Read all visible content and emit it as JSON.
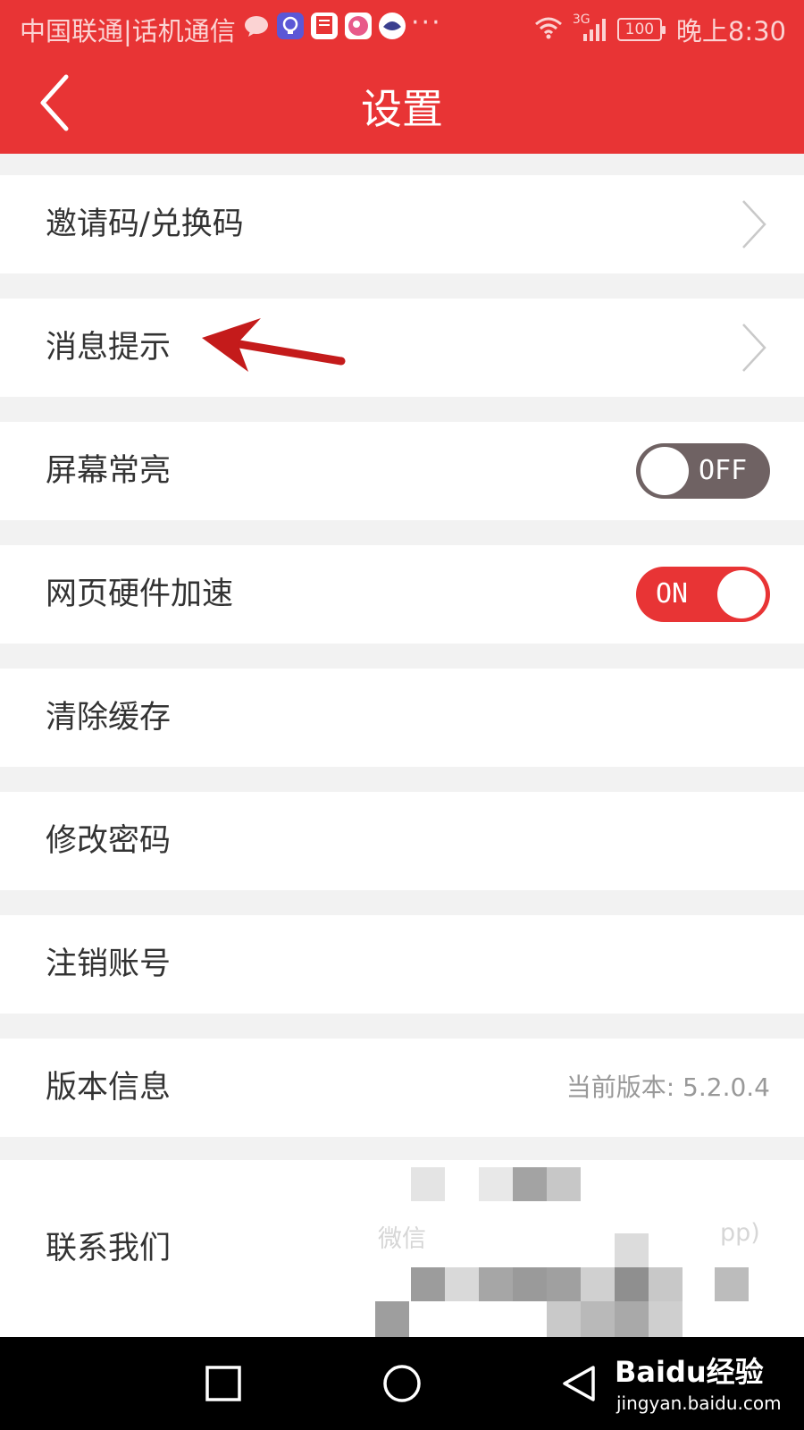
{
  "status_bar": {
    "carrier": "中国联通|话机通信",
    "more": "···",
    "network": "3G",
    "battery": "100",
    "time": "晚上8:30",
    "notification_icons": [
      "chat-bubble-icon",
      "lightbulb-app-icon",
      "document-app-icon",
      "heart-app-icon",
      "bird-app-icon"
    ]
  },
  "header": {
    "title": "设置",
    "back_icon": "chevron-left-icon",
    "color": "#e83435"
  },
  "settings": {
    "invite_code": "邀请码/兑换码",
    "message_notice": "消息提示",
    "screen_on": {
      "label": "屏幕常亮",
      "toggle": "OFF",
      "state": false
    },
    "hw_accel": {
      "label": "网页硬件加速",
      "toggle": "ON",
      "state": true
    },
    "clear_cache": "清除缓存",
    "change_password": "修改密码",
    "delete_account": "注销账号",
    "version": {
      "label": "版本信息",
      "value": "当前版本: 5.2.0.4"
    },
    "contact": {
      "label": "联系我们",
      "value": "微信",
      "value_tail": "pp)"
    }
  },
  "nav_bar": {
    "buttons": [
      "recents-square-icon",
      "home-circle-icon",
      "back-triangle-icon"
    ]
  },
  "watermark": {
    "logo": "Baidu经验",
    "url": "jingyan.baidu.com"
  },
  "colors": {
    "accent": "#e83435",
    "toggle_off": "#6f6263",
    "background": "#f2f2f2"
  }
}
